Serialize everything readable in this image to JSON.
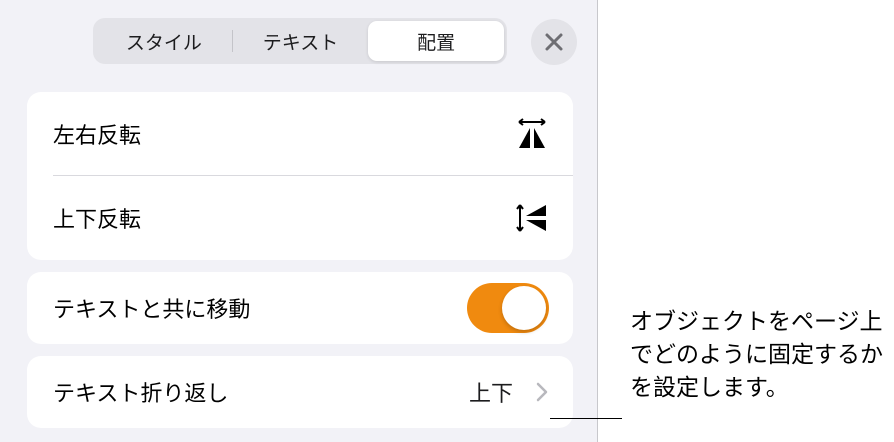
{
  "tabs": [
    {
      "label": "スタイル"
    },
    {
      "label": "テキスト"
    },
    {
      "label": "配置",
      "selected": true
    }
  ],
  "flip_group": {
    "rows": [
      {
        "label": "左右反転",
        "icon": "flip-horizontal-icon"
      },
      {
        "label": "上下反転",
        "icon": "flip-vertical-icon"
      }
    ]
  },
  "move_with_text": {
    "label": "テキストと共に移動",
    "toggle_on": true,
    "toggle_color": "#f08a0f"
  },
  "text_wrap": {
    "label": "テキスト折り返し",
    "value": "上下"
  },
  "callout": {
    "text": "オブジェクトをページ上でどのように固定するかを設定します。"
  }
}
